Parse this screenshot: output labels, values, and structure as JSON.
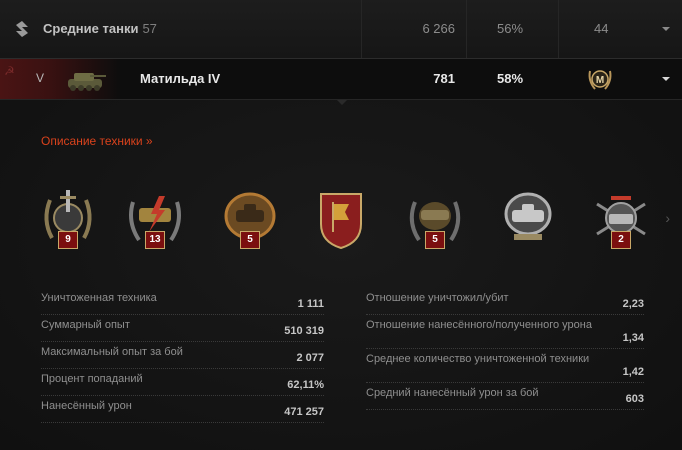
{
  "category_row": {
    "icon": "medium-tank-class-icon",
    "name": "Средние танки",
    "count": "57",
    "battles": "6 266",
    "win_rate": "56%",
    "mastery_count": "44"
  },
  "tank_row": {
    "nation_icon": "ussr-hammer-sickle-icon",
    "tier": "V",
    "name": "Матильда IV",
    "battles": "781",
    "win_rate": "58%",
    "mastery_badge_letter": "M"
  },
  "description_link": "Описание техники »",
  "medals": [
    {
      "icon": "medal-sword-wreath-icon",
      "count": "9"
    },
    {
      "icon": "medal-tank-lightning-icon",
      "count": "13"
    },
    {
      "icon": "medal-tank-bronze-icon",
      "count": "5"
    },
    {
      "icon": "medal-red-banner-shield-icon",
      "count": ""
    },
    {
      "icon": "medal-tank-wreath-icon",
      "count": "5"
    },
    {
      "icon": "medal-silver-tank-icon",
      "count": ""
    },
    {
      "icon": "medal-tank-crossed-guns-icon",
      "count": "2"
    }
  ],
  "stats_left": [
    {
      "label": "Уничтоженная техника",
      "value": "1 111"
    },
    {
      "label": "Суммарный опыт",
      "value": "510 319"
    },
    {
      "label": "Максимальный опыт за бой",
      "value": "2 077"
    },
    {
      "label": "Процент попаданий",
      "value": "62,11%"
    },
    {
      "label": "Нанесённый урон",
      "value": "471 257"
    }
  ],
  "stats_right": [
    {
      "label": "Отношение уничтожил/убит",
      "value": "2,23"
    },
    {
      "label": "Отношение нанесённого/полученного урона",
      "value": "1,34"
    },
    {
      "label": "Среднее количество уничтоженной техники",
      "value": "1,42"
    },
    {
      "label": "Средний нанесённый урон за бой",
      "value": "603"
    }
  ],
  "colors": {
    "accent_link": "#d9421c",
    "badge_bg": "#7b0f0f",
    "badge_border": "#c9a868"
  }
}
